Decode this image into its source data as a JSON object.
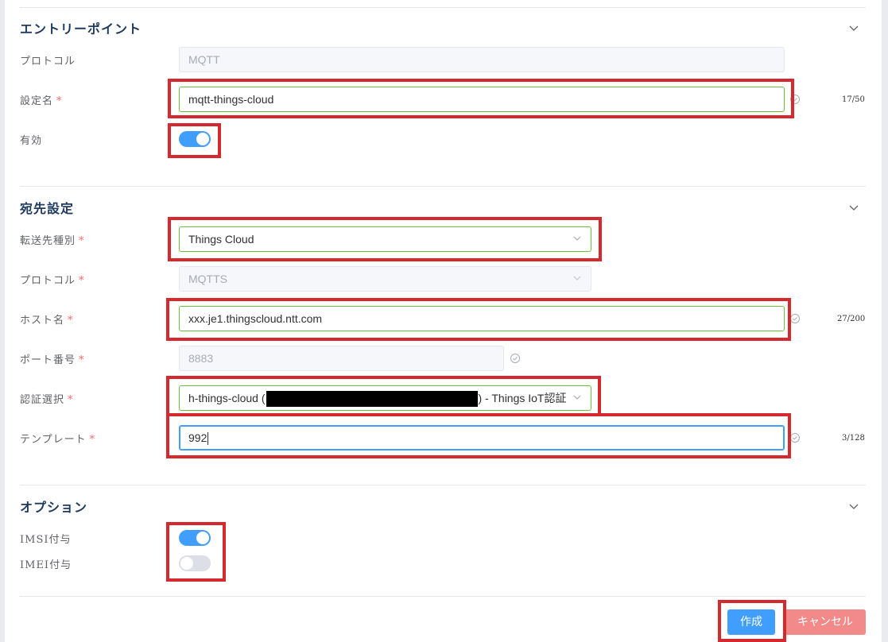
{
  "sections": {
    "entry": {
      "title": "エントリーポイント",
      "protocol_label": "プロトコル",
      "protocol_value": "MQTT",
      "name_label": "設定名",
      "name_value": "mqtt-things-cloud",
      "name_counter": "17/50",
      "enabled_label": "有効",
      "enabled": true
    },
    "dest": {
      "title": "宛先設定",
      "type_label": "転送先種別",
      "type_value": "Things Cloud",
      "protocol_label": "プロトコル",
      "protocol_value": "MQTTS",
      "host_label": "ホスト名",
      "host_value": "xxx.je1.thingscloud.ntt.com",
      "host_counter": "27/200",
      "port_label": "ポート番号",
      "port_value": "8883",
      "auth_label": "認証選択",
      "auth_value_prefix": "h-things-cloud (",
      "auth_value_suffix": ") - Things IoT認証",
      "template_label": "テンプレート",
      "template_value": "992",
      "template_counter": "3/128"
    },
    "options": {
      "title": "オプション",
      "imsi_label": "IMSI付与",
      "imsi_enabled": true,
      "imei_label": "IMEI付与",
      "imei_enabled": false
    }
  },
  "required_mark": "*",
  "buttons": {
    "create": "作成",
    "cancel": "キャンセル"
  },
  "colors": {
    "primary": "#409eff",
    "success": "#67c23a",
    "danger": "#f56c6c",
    "highlight": "#d42a2f"
  }
}
